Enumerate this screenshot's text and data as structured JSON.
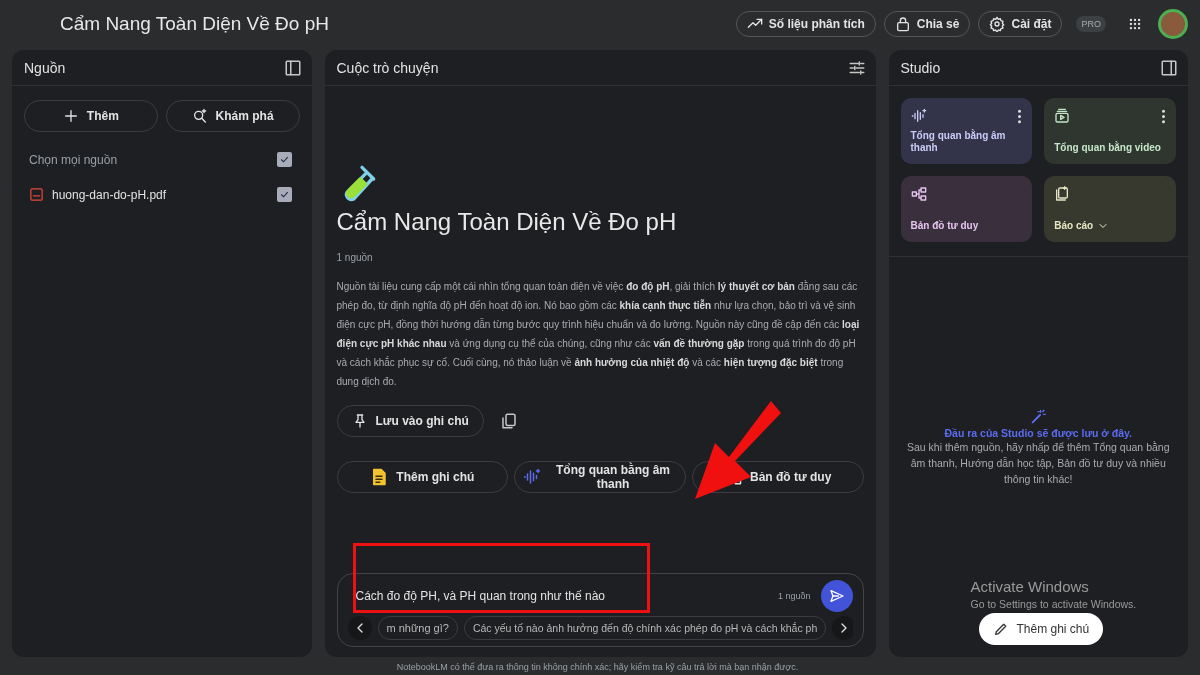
{
  "header": {
    "title": "Cẩm Nang Toàn Diện Về Đo pH",
    "buttons": [
      {
        "kind": "analytics",
        "label": "Số liệu phân tích"
      },
      {
        "kind": "share",
        "label": "Chia sẻ"
      },
      {
        "kind": "settings",
        "label": "Cài đặt"
      }
    ],
    "badge": "PRO"
  },
  "sources": {
    "title": "Nguồn",
    "buttons": [
      {
        "kind": "add",
        "label": "Thêm"
      },
      {
        "kind": "discover",
        "label": "Khám phá"
      }
    ],
    "select_all": {
      "label": "Chọn mọi nguồn",
      "checked": true
    },
    "items": [
      {
        "name": "huong-dan-do-pH.pdf",
        "checked": true
      }
    ]
  },
  "chat": {
    "title": "Cuộc trò chuyện",
    "heading": "Cẩm Nang Toàn Diện Về Đo pH",
    "source_count": "1 nguồn",
    "summary": "Nguồn tài liệu cung cấp một cái nhìn tổng quan toàn diện về việc **đo độ pH**, giải thích **lý thuyết cơ bản** đằng sau các phép đo, từ định nghĩa độ pH đến hoạt độ ion. Nó bao gồm các **khía cạnh thực tiễn** như lựa chọn, bảo trì và vệ sinh điện cực pH, đồng thời hướng dẫn từng bước quy trình hiệu chuẩn và đo lường. Nguồn này cũng đề cập đến các **loại điện cực pH khác nhau** và ứng dụng cụ thể của chúng, cũng như các **vấn đề thường gặp** trong quá trình đo độ pH và cách khắc phục sự cố. Cuối cùng, nó thảo luận về **ảnh hưởng của nhiệt độ** và các **hiện tượng đặc biệt** trong dung dịch đo.",
    "save_button": "Lưu vào ghi chú",
    "actions": [
      {
        "kind": "note",
        "label": "Thêm ghi chú"
      },
      {
        "kind": "audio",
        "label": "Tổng quan bằng âm thanh"
      },
      {
        "kind": "mindmap",
        "label": "Bản đồ tư duy"
      }
    ],
    "input": {
      "value": "Cách đo độ PH, và PH quan trong như thế nào",
      "source_count": "1 nguồn"
    },
    "suggestions": [
      "m những gì?",
      "Các yếu tố nào ảnh hưởng đến độ chính xác phép đo pH và cách khắc ph"
    ],
    "disclaimer": "NotebookLM có thể đưa ra thông tin không chính xác; hãy kiểm tra kỹ câu trả lời mà bạn nhận được."
  },
  "studio": {
    "title": "Studio",
    "tiles": [
      {
        "kind": "audio",
        "label": "Tổng quan bằng âm thanh",
        "color": "#33344a",
        "has_menu": true
      },
      {
        "kind": "video",
        "label": "Tổng quan bằng video",
        "color": "#2f3630",
        "has_menu": true
      },
      {
        "kind": "mindmap",
        "label": "Bản đồ tư duy",
        "color": "#3a2f3d",
        "has_menu": false
      },
      {
        "kind": "report",
        "label": "Báo cáo",
        "color": "#37382e",
        "has_menu": false
      }
    ],
    "empty_title": "Đầu ra của Studio sẽ được lưu ở đây.",
    "empty_text": "Sau khi thêm nguồn, hãy nhấp để thêm Tổng quan bằng âm thanh, Hướng dẫn học tập, Bản đồ tư duy và nhiều thông tin khác!",
    "add_note_button": "Thêm ghi chú"
  },
  "activate_windows": {
    "title": "Activate Windows",
    "subtitle": "Go to Settings to activate Windows."
  }
}
